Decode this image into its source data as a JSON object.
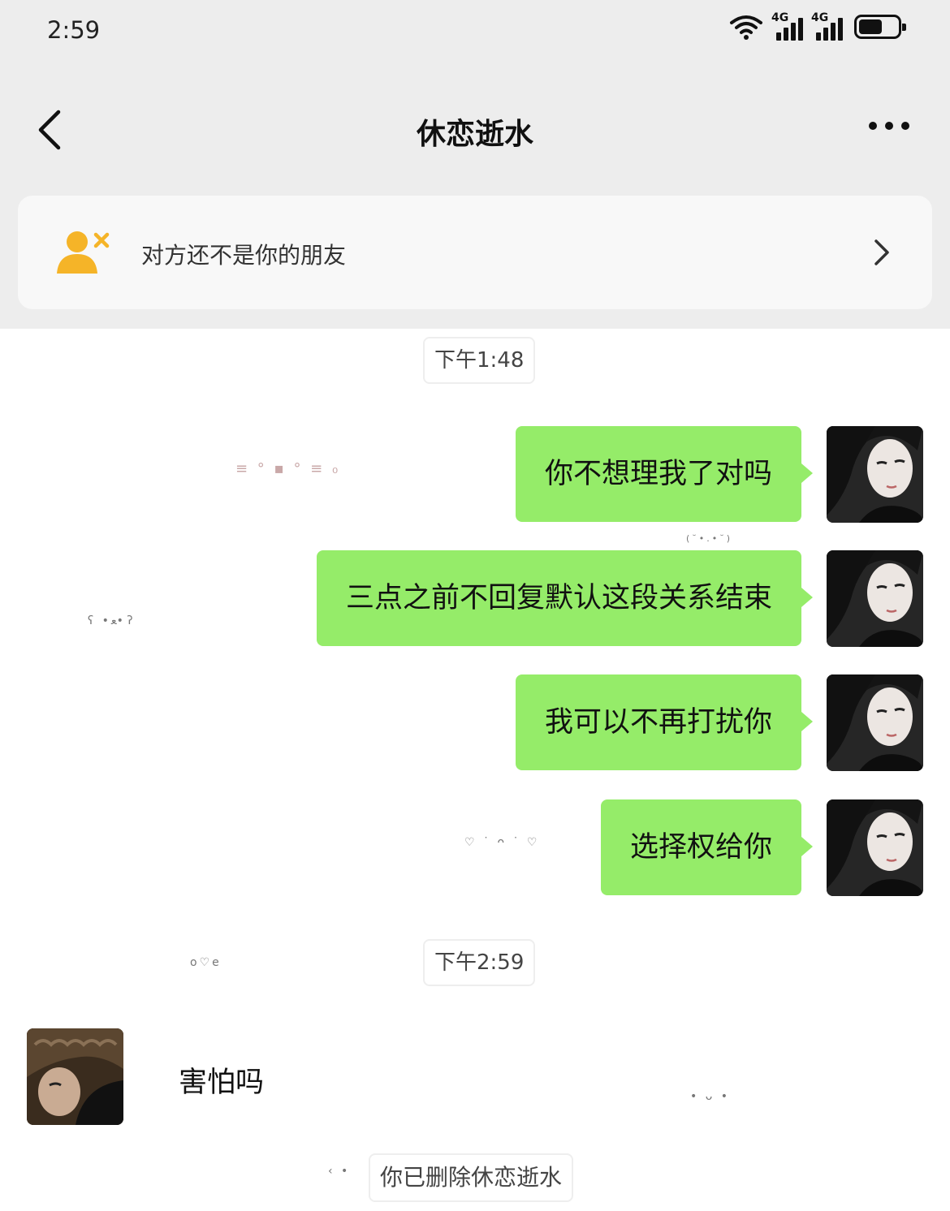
{
  "status_bar": {
    "time": "2:59",
    "network_1": "4G",
    "network_2": "4G",
    "battery_level": 0.6
  },
  "header": {
    "title": "休恋逝水",
    "back_icon": "chevron-left-icon",
    "more_icon": "ellipsis-icon"
  },
  "notice": {
    "text": "对方还不是你的朋友",
    "icon": "user-not-friend-icon",
    "accent_color": "#f5b428"
  },
  "chat": {
    "time_labels": [
      "下午1:48",
      "下午2:59"
    ],
    "sent_messages": [
      "你不想理我了对吗",
      "三点之前不回复默认这段关系结束",
      "我可以不再打扰你",
      "选择权给你"
    ],
    "received_message": "害怕吗",
    "system_message": "你已删除休恋逝水",
    "bubble_color": "#95ec69",
    "decorations": [
      "(˘•.•˘)",
      "ʕ •ﻌ• ʔ",
      "♡ ˙ ᴖ ˙ ♡",
      "o♡e",
      "• ᴗ •",
      "‹ •"
    ]
  }
}
